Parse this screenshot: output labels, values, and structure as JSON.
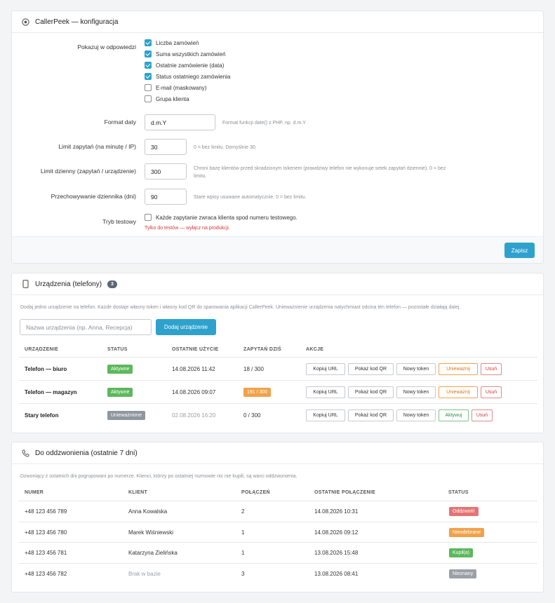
{
  "config": {
    "title": "CallerPeek — konfiguracja",
    "show_label": "Pokazuj w odpowiedzi",
    "options": [
      {
        "label": "Liczba zamówień",
        "checked": true
      },
      {
        "label": "Suma wszystkich zamówień",
        "checked": true
      },
      {
        "label": "Ostatnie zamówienie (data)",
        "checked": true
      },
      {
        "label": "Status ostatniego zamówienia",
        "checked": true
      },
      {
        "label": "E-mail (maskowany)",
        "checked": false
      },
      {
        "label": "Grupa klienta",
        "checked": false
      }
    ],
    "date_format": {
      "label": "Format daty",
      "value": "d.m.Y",
      "help": "Format funkcji date() z PHP, np. d.m.Y"
    },
    "rate_limit": {
      "label": "Limit zapytań (na minutę / IP)",
      "value": "30",
      "help": "0 = bez limitu. Domyślnie 30."
    },
    "daily_limit": {
      "label": "Limit dzienny (zapytań / urządzenie)",
      "value": "300",
      "help_line1": "Chroni bazę klientów przed skradzionym tokenem (prawdziwy telefon nie wykonuje setek zapytań dziennie). 0 = bez",
      "help_line2": "limitu."
    },
    "log_retention": {
      "label": "Przechowywanie dziennika (dni)",
      "value": "90",
      "help": "Stare wpisy usuwane automatycznie. 0 = bez limitu."
    },
    "test_mode": {
      "label": "Tryb testowy",
      "checkbox_label": "Każde zapytanie zwraca klienta spod numeru testowego.",
      "checked": false,
      "warning": "Tylko do testów — wyłącz na produkcji."
    },
    "save_label": "Zapisz"
  },
  "devices": {
    "title": "Urządzenia (telefony)",
    "count": "3",
    "intro": "Dodaj jedno urządzenie na telefon. Każde dostaje własny token i własny kod QR do sparowania aplikacji CallerPeek. Unieważnienie urządzenia natychmiast odcina ten telefon — pozostałe działają dalej.",
    "name_placeholder": "Nazwa urządzenia (np. Anna, Recepcja)",
    "add_label": "Dodaj urządzenie",
    "columns": [
      "URZĄDZENIE",
      "STATUS",
      "OSTATNIE UŻYCIE",
      "ZAPYTAŃ DZIŚ",
      "AKCJE"
    ],
    "rows": [
      {
        "name": "Telefon — biuro",
        "status": "Aktywne",
        "last_used": "14.08.2026 11:42",
        "queries": "18 / 300",
        "actions": [
          "Kopiuj URL",
          "Pokaż kod QR",
          "Nowy token",
          "Unieważnij",
          "Usuń"
        ]
      },
      {
        "name": "Telefon — magazyn",
        "status": "Aktywne",
        "last_used": "14.08.2026 09:07",
        "queries": "191 / 300",
        "actions": [
          "Kopiuj URL",
          "Pokaż kod QR",
          "Nowy token",
          "Unieważnij",
          "Usuń"
        ]
      },
      {
        "name": "Stary telefon",
        "status": "Unieważnione",
        "last_used": "02.08.2026 16:20",
        "queries": "0 / 300",
        "actions": [
          "Kopiuj URL",
          "Pokaż kod QR",
          "Nowy token",
          "Aktywuj",
          "Usuń"
        ]
      }
    ],
    "colors": {
      "active": "#5cb85c",
      "revoked": "#8f969e",
      "warn": "#f0a24a"
    }
  },
  "callbacks": {
    "title": "Do oddzwonienia (ostatnie 7 dni)",
    "intro": "Dzwoniący z ostatnich dni pogrupowani po numerze. Klienci, którzy po ostatniej rozmowie nic nie kupili, są warci oddzwonienia.",
    "columns": [
      "NUMER",
      "KLIENT",
      "POŁĄCZEŃ",
      "OSTATNIE POŁĄCZENIE",
      "STATUS"
    ],
    "rows": [
      {
        "number": "+48 123 456 789",
        "client": "Anna Kowalska",
        "calls": "2",
        "last_call": "14.08.2026 10:31",
        "status": "Oddzwoń!"
      },
      {
        "number": "+48 123 456 780",
        "client": "Marek Wiśniewski",
        "calls": "1",
        "last_call": "14.08.2026 09:12",
        "status": "Nieodebrane"
      },
      {
        "number": "+48 123 456 781",
        "client": "Katarzyna Zielińska",
        "calls": "1",
        "last_call": "13.08.2026 15:48",
        "status": "Kupił(a)"
      },
      {
        "number": "+48 123 456 782",
        "client": "Brak w bazie",
        "calls": "3",
        "last_call": "13.08.2026 08:41",
        "status": "Nieznany"
      }
    ],
    "status_colors": {
      "Oddzwoń!": "#e57373",
      "Nieodebrane": "#f0a24a",
      "Kupił(a)": "#5cb85c",
      "Nieznany": "#9aa0a6"
    }
  }
}
